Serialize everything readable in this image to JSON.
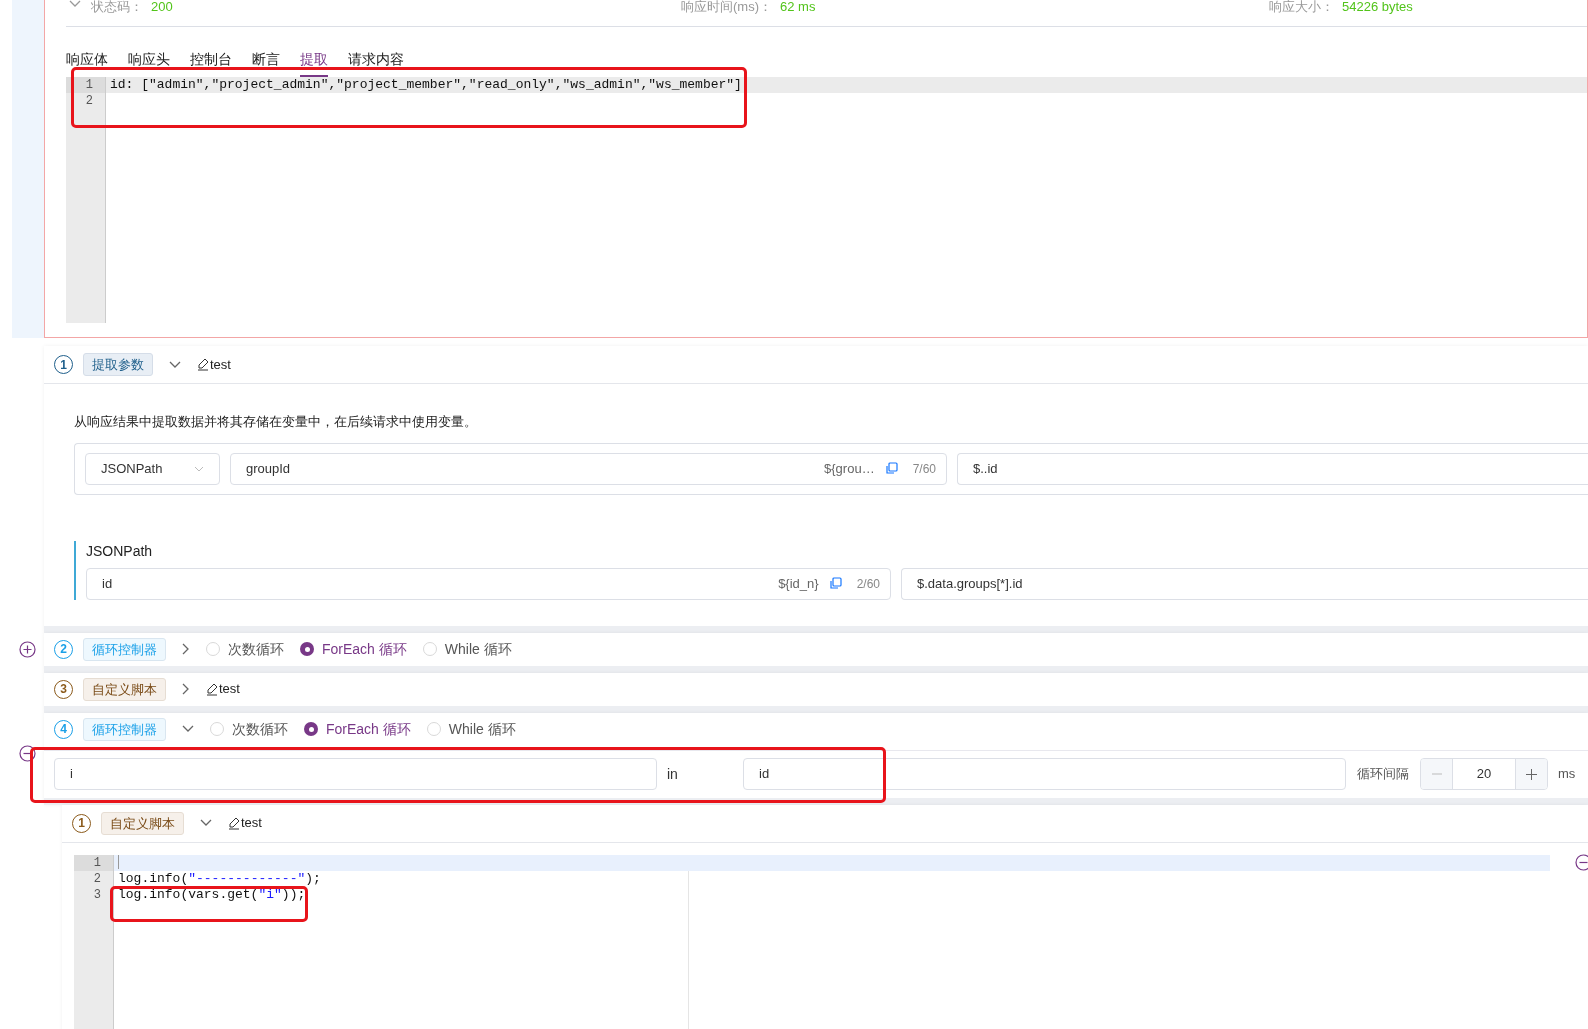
{
  "response": {
    "status_label": "状态码：",
    "status": "200",
    "time_label": "响应时间(ms)：",
    "time": "62 ms",
    "size_label": "响应大小：",
    "size": "54226 bytes",
    "tabs": [
      {
        "label": "响应体",
        "selected": false
      },
      {
        "label": "响应头",
        "selected": false
      },
      {
        "label": "控制台",
        "selected": false
      },
      {
        "label": "断言",
        "selected": false
      },
      {
        "label": "提取",
        "selected": true
      },
      {
        "label": "请求内容",
        "selected": false
      }
    ],
    "editor_lines": [
      {
        "number": "1",
        "active": true,
        "segments": [
          {
            "kind": "plain",
            "text": "id: [\"admin\",\"project_admin\",\"project_member\",\"read_only\",\"ws_admin\",\"ws_member\"]"
          }
        ]
      },
      {
        "number": "2",
        "active": false
      }
    ]
  },
  "steps": [
    {
      "kind": "extract",
      "number": "1",
      "tag": "提取参数",
      "expanded": true,
      "name": "test",
      "description": "从响应结果中提取数据并将其存储在变量中，在后续请求中使用变量。",
      "rule": {
        "type": "JSONPath",
        "name": "groupId",
        "reference": "${grou…",
        "count": "7/60",
        "expression": "$..id"
      },
      "section": {
        "title": "JSONPath",
        "name": "id",
        "reference": "${id_n}",
        "count": "2/60",
        "expression": "$.data.groups[*].id"
      }
    },
    {
      "kind": "loop",
      "number": "2",
      "tag": "循环控制器",
      "expanded": false,
      "options": [
        {
          "label": "次数循环",
          "selected": false
        },
        {
          "label": "ForEach 循环",
          "selected": true
        },
        {
          "label": "While 循环",
          "selected": false
        }
      ]
    },
    {
      "kind": "script",
      "number": "3",
      "tag": "自定义脚本",
      "expanded": false,
      "name": "test"
    },
    {
      "kind": "loop",
      "number": "4",
      "tag": "循环控制器",
      "expanded": true,
      "options": [
        {
          "label": "次数循环",
          "selected": false
        },
        {
          "label": "ForEach 循环",
          "selected": true
        },
        {
          "label": "While 循环",
          "selected": false
        }
      ],
      "foreach": {
        "variable": "i",
        "in_label": "in",
        "list": "id",
        "interval_label": "循环间隔",
        "interval": "20",
        "unit": "ms"
      },
      "children": [
        {
          "kind": "script",
          "number": "1",
          "tag": "自定义脚本",
          "expanded": true,
          "name": "test",
          "code": [
            {
              "number": "1",
              "active": true
            },
            {
              "number": "2",
              "active": false,
              "segments": [
                {
                  "kind": "plain",
                  "text": "log.info("
                },
                {
                  "kind": "string",
                  "text": "\"-------------\""
                },
                {
                  "kind": "plain",
                  "text": ");"
                }
              ]
            },
            {
              "number": "3",
              "active": false,
              "segments": [
                {
                  "kind": "plain",
                  "text": "log.info(vars.get("
                },
                {
                  "kind": "string",
                  "text": "\"i\""
                },
                {
                  "kind": "plain",
                  "text": "));"
                }
              ]
            }
          ]
        }
      ]
    }
  ]
}
